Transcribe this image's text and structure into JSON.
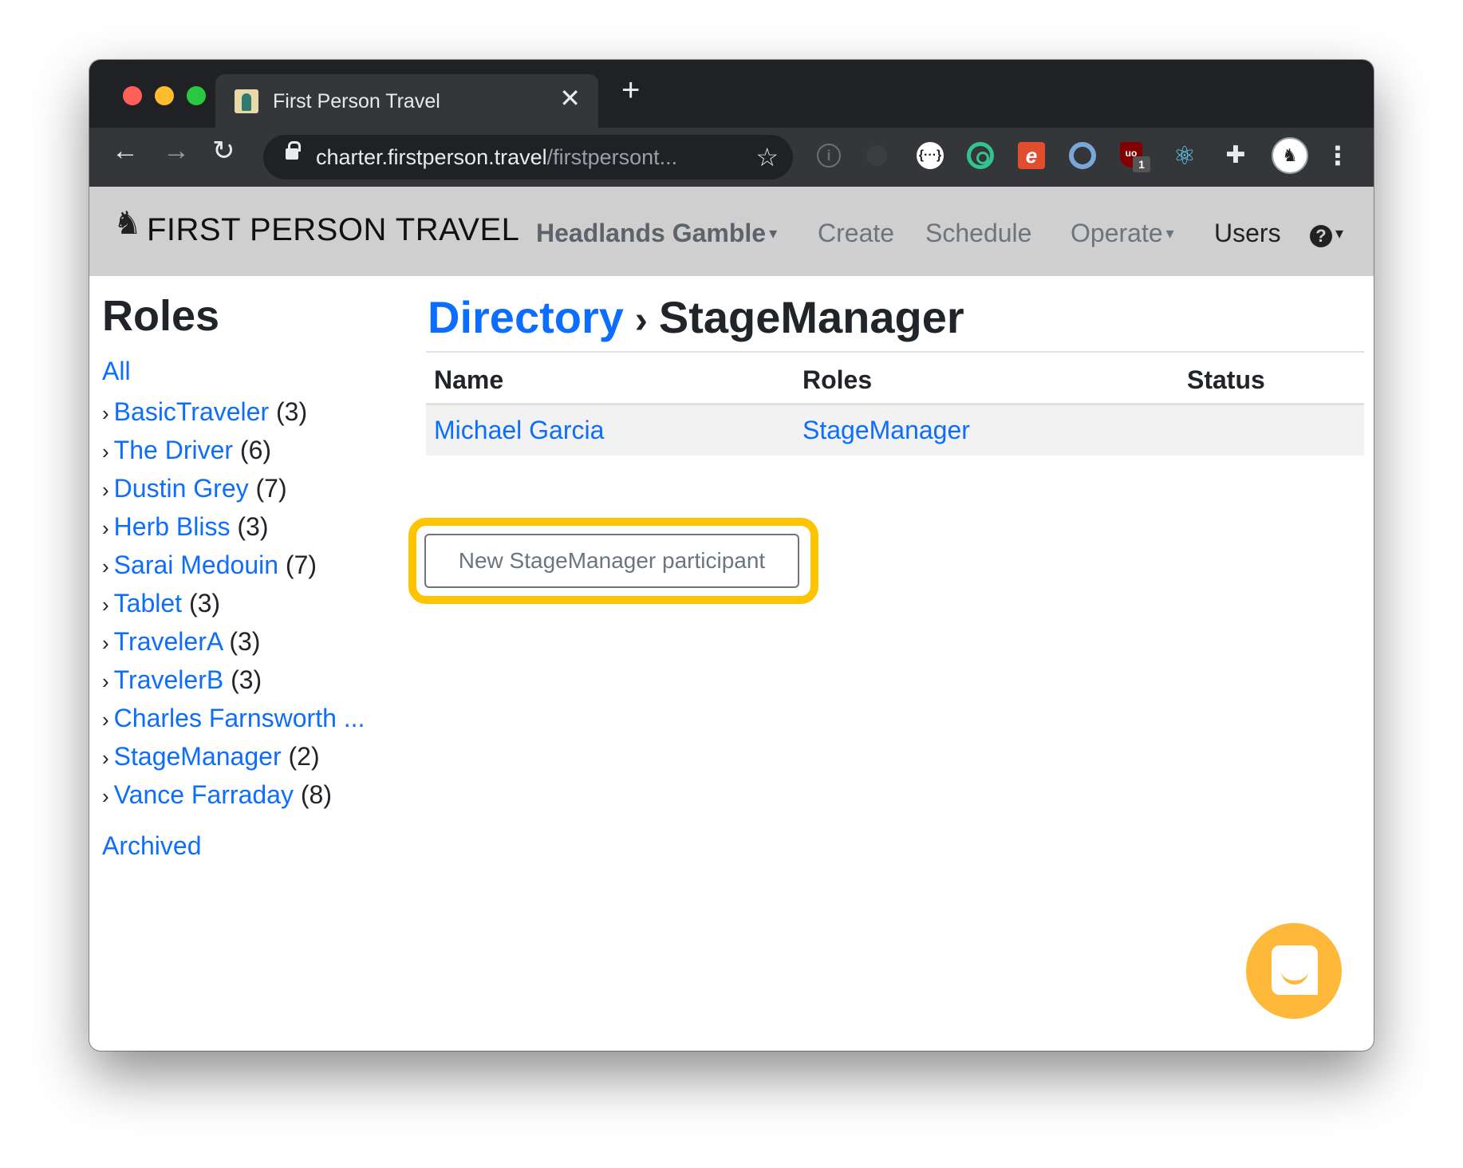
{
  "browser": {
    "tab_title": "First Person Travel",
    "tab_close": "✕",
    "new_tab": "+",
    "url_host": "charter.firstperson.travel",
    "url_path": "/firstpersont...",
    "back": "←",
    "forward": "→",
    "reload": "↻",
    "star": "☆",
    "extensions": [
      "info-icon",
      "dim-extension",
      "braces-extension",
      "target-extension",
      "e-extension",
      "ring-extension",
      "ublock-extension",
      "react-devtools-extension",
      "puzzle-extensions-icon",
      "profile-avatar"
    ],
    "ublock_label": "uo",
    "ublock_badge": "1",
    "kebab": "⋮",
    "puzzle_glyph": "✚",
    "react_glyph": "⚛",
    "braces_glyph": "{···}",
    "info_glyph": "i",
    "avatar_glyph": "♞",
    "e_glyph": "e"
  },
  "site_nav": {
    "brand": "FIRST PERSON TRAVEL",
    "brand_icon": "♞",
    "project": "Headlands Gamble",
    "create": "Create",
    "schedule": "Schedule",
    "operate": "Operate",
    "users": "Users",
    "help_glyph": "?",
    "caret": "▾"
  },
  "sidebar": {
    "heading": "Roles",
    "all": "All",
    "chevron": "›",
    "roles": [
      {
        "name": "BasicTraveler",
        "count": "(3)"
      },
      {
        "name": "The Driver",
        "count": "(6)"
      },
      {
        "name": "Dustin Grey",
        "count": "(7)"
      },
      {
        "name": "Herb Bliss",
        "count": "(3)"
      },
      {
        "name": "Sarai Medouin",
        "count": "(7)"
      },
      {
        "name": "Tablet",
        "count": "(3)"
      },
      {
        "name": "TravelerA",
        "count": "(3)"
      },
      {
        "name": "TravelerB",
        "count": "(3)"
      },
      {
        "name": "Charles Farnsworth ...",
        "count": ""
      },
      {
        "name": "StageManager",
        "count": "(2)"
      },
      {
        "name": "Vance Farraday",
        "count": "(8)"
      }
    ],
    "archived": "Archived"
  },
  "main": {
    "breadcrumb_link": "Directory",
    "breadcrumb_sep": "›",
    "breadcrumb_current": "StageManager",
    "columns": [
      "Name",
      "Roles",
      "Status"
    ],
    "rows": [
      {
        "name": "Michael Garcia",
        "roles": "StageManager",
        "status": ""
      }
    ],
    "new_button": "New StageManager participant"
  },
  "colors": {
    "link": "#0d6efd",
    "highlight": "#ffc400",
    "chat_bubble": "#ffb93a",
    "navbar_bg": "#cfcfcf"
  }
}
